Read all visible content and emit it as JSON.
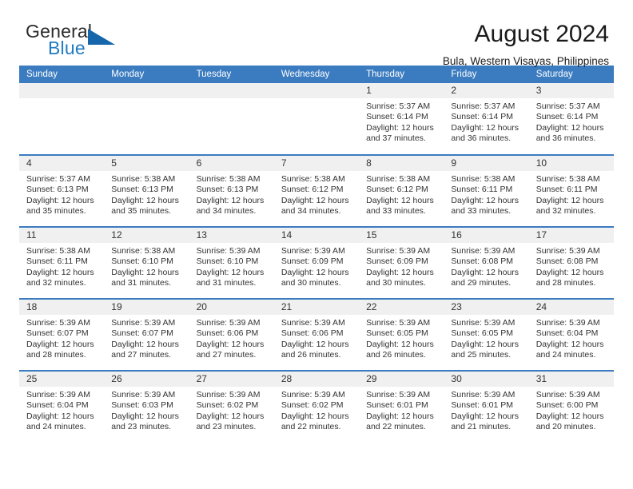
{
  "brand": {
    "name_top": "General",
    "name_bottom": "Blue",
    "accent_color": "#1f7bc1",
    "triangle_color": "#1566ab"
  },
  "header": {
    "title": "August 2024",
    "subtitle": "Bula, Western Visayas, Philippines"
  },
  "theme": {
    "header_blue": "#3b7cc0",
    "daynum_band": "#f0f0f0",
    "text": "#333333"
  },
  "weekday_headers": [
    "Sunday",
    "Monday",
    "Tuesday",
    "Wednesday",
    "Thursday",
    "Friday",
    "Saturday"
  ],
  "weeks": [
    [
      {
        "day": "",
        "lines": []
      },
      {
        "day": "",
        "lines": []
      },
      {
        "day": "",
        "lines": []
      },
      {
        "day": "",
        "lines": []
      },
      {
        "day": "1",
        "lines": [
          "Sunrise: 5:37 AM",
          "Sunset: 6:14 PM",
          "Daylight: 12 hours",
          "and 37 minutes."
        ]
      },
      {
        "day": "2",
        "lines": [
          "Sunrise: 5:37 AM",
          "Sunset: 6:14 PM",
          "Daylight: 12 hours",
          "and 36 minutes."
        ]
      },
      {
        "day": "3",
        "lines": [
          "Sunrise: 5:37 AM",
          "Sunset: 6:14 PM",
          "Daylight: 12 hours",
          "and 36 minutes."
        ]
      }
    ],
    [
      {
        "day": "4",
        "lines": [
          "Sunrise: 5:37 AM",
          "Sunset: 6:13 PM",
          "Daylight: 12 hours",
          "and 35 minutes."
        ]
      },
      {
        "day": "5",
        "lines": [
          "Sunrise: 5:38 AM",
          "Sunset: 6:13 PM",
          "Daylight: 12 hours",
          "and 35 minutes."
        ]
      },
      {
        "day": "6",
        "lines": [
          "Sunrise: 5:38 AM",
          "Sunset: 6:13 PM",
          "Daylight: 12 hours",
          "and 34 minutes."
        ]
      },
      {
        "day": "7",
        "lines": [
          "Sunrise: 5:38 AM",
          "Sunset: 6:12 PM",
          "Daylight: 12 hours",
          "and 34 minutes."
        ]
      },
      {
        "day": "8",
        "lines": [
          "Sunrise: 5:38 AM",
          "Sunset: 6:12 PM",
          "Daylight: 12 hours",
          "and 33 minutes."
        ]
      },
      {
        "day": "9",
        "lines": [
          "Sunrise: 5:38 AM",
          "Sunset: 6:11 PM",
          "Daylight: 12 hours",
          "and 33 minutes."
        ]
      },
      {
        "day": "10",
        "lines": [
          "Sunrise: 5:38 AM",
          "Sunset: 6:11 PM",
          "Daylight: 12 hours",
          "and 32 minutes."
        ]
      }
    ],
    [
      {
        "day": "11",
        "lines": [
          "Sunrise: 5:38 AM",
          "Sunset: 6:11 PM",
          "Daylight: 12 hours",
          "and 32 minutes."
        ]
      },
      {
        "day": "12",
        "lines": [
          "Sunrise: 5:38 AM",
          "Sunset: 6:10 PM",
          "Daylight: 12 hours",
          "and 31 minutes."
        ]
      },
      {
        "day": "13",
        "lines": [
          "Sunrise: 5:39 AM",
          "Sunset: 6:10 PM",
          "Daylight: 12 hours",
          "and 31 minutes."
        ]
      },
      {
        "day": "14",
        "lines": [
          "Sunrise: 5:39 AM",
          "Sunset: 6:09 PM",
          "Daylight: 12 hours",
          "and 30 minutes."
        ]
      },
      {
        "day": "15",
        "lines": [
          "Sunrise: 5:39 AM",
          "Sunset: 6:09 PM",
          "Daylight: 12 hours",
          "and 30 minutes."
        ]
      },
      {
        "day": "16",
        "lines": [
          "Sunrise: 5:39 AM",
          "Sunset: 6:08 PM",
          "Daylight: 12 hours",
          "and 29 minutes."
        ]
      },
      {
        "day": "17",
        "lines": [
          "Sunrise: 5:39 AM",
          "Sunset: 6:08 PM",
          "Daylight: 12 hours",
          "and 28 minutes."
        ]
      }
    ],
    [
      {
        "day": "18",
        "lines": [
          "Sunrise: 5:39 AM",
          "Sunset: 6:07 PM",
          "Daylight: 12 hours",
          "and 28 minutes."
        ]
      },
      {
        "day": "19",
        "lines": [
          "Sunrise: 5:39 AM",
          "Sunset: 6:07 PM",
          "Daylight: 12 hours",
          "and 27 minutes."
        ]
      },
      {
        "day": "20",
        "lines": [
          "Sunrise: 5:39 AM",
          "Sunset: 6:06 PM",
          "Daylight: 12 hours",
          "and 27 minutes."
        ]
      },
      {
        "day": "21",
        "lines": [
          "Sunrise: 5:39 AM",
          "Sunset: 6:06 PM",
          "Daylight: 12 hours",
          "and 26 minutes."
        ]
      },
      {
        "day": "22",
        "lines": [
          "Sunrise: 5:39 AM",
          "Sunset: 6:05 PM",
          "Daylight: 12 hours",
          "and 26 minutes."
        ]
      },
      {
        "day": "23",
        "lines": [
          "Sunrise: 5:39 AM",
          "Sunset: 6:05 PM",
          "Daylight: 12 hours",
          "and 25 minutes."
        ]
      },
      {
        "day": "24",
        "lines": [
          "Sunrise: 5:39 AM",
          "Sunset: 6:04 PM",
          "Daylight: 12 hours",
          "and 24 minutes."
        ]
      }
    ],
    [
      {
        "day": "25",
        "lines": [
          "Sunrise: 5:39 AM",
          "Sunset: 6:04 PM",
          "Daylight: 12 hours",
          "and 24 minutes."
        ]
      },
      {
        "day": "26",
        "lines": [
          "Sunrise: 5:39 AM",
          "Sunset: 6:03 PM",
          "Daylight: 12 hours",
          "and 23 minutes."
        ]
      },
      {
        "day": "27",
        "lines": [
          "Sunrise: 5:39 AM",
          "Sunset: 6:02 PM",
          "Daylight: 12 hours",
          "and 23 minutes."
        ]
      },
      {
        "day": "28",
        "lines": [
          "Sunrise: 5:39 AM",
          "Sunset: 6:02 PM",
          "Daylight: 12 hours",
          "and 22 minutes."
        ]
      },
      {
        "day": "29",
        "lines": [
          "Sunrise: 5:39 AM",
          "Sunset: 6:01 PM",
          "Daylight: 12 hours",
          "and 22 minutes."
        ]
      },
      {
        "day": "30",
        "lines": [
          "Sunrise: 5:39 AM",
          "Sunset: 6:01 PM",
          "Daylight: 12 hours",
          "and 21 minutes."
        ]
      },
      {
        "day": "31",
        "lines": [
          "Sunrise: 5:39 AM",
          "Sunset: 6:00 PM",
          "Daylight: 12 hours",
          "and 20 minutes."
        ]
      }
    ]
  ]
}
